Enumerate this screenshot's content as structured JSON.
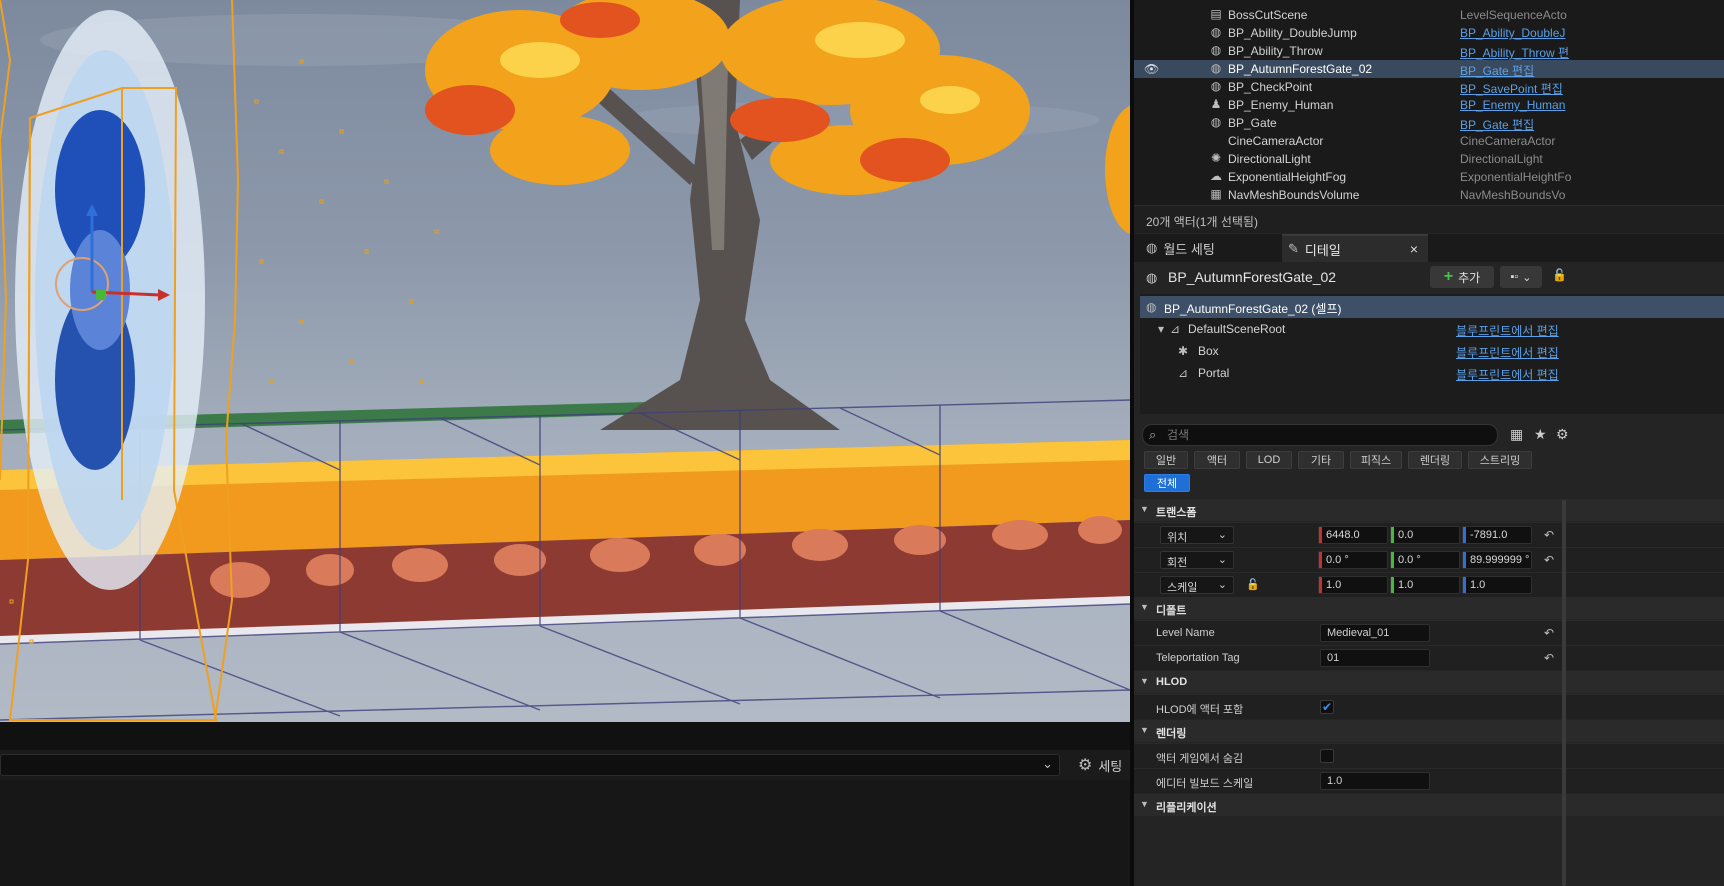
{
  "outliner": {
    "rows": [
      {
        "name": "BossCutScene",
        "type": "LevelSequenceActo",
        "link": false,
        "selected": false,
        "icon": "sequence-icon",
        "glyph": "▤"
      },
      {
        "name": "BP_Ability_DoubleJump",
        "type": "BP_Ability_DoubleJ",
        "link": true,
        "selected": false,
        "icon": "blueprint-actor-icon",
        "glyph": "◍"
      },
      {
        "name": "BP_Ability_Throw",
        "type": "BP_Ability_Throw 편",
        "link": true,
        "selected": false,
        "icon": "blueprint-actor-icon",
        "glyph": "◍"
      },
      {
        "name": "BP_AutumnForestGate_02",
        "type": "BP_Gate 편집",
        "link": true,
        "selected": true,
        "icon": "blueprint-actor-icon",
        "glyph": "◍"
      },
      {
        "name": "BP_CheckPoint",
        "type": "BP_SavePoint 편집",
        "link": true,
        "selected": false,
        "icon": "blueprint-actor-icon",
        "glyph": "◍"
      },
      {
        "name": "BP_Enemy_Human",
        "type": "BP_Enemy_Human",
        "link": true,
        "selected": false,
        "icon": "character-icon",
        "glyph": "♟"
      },
      {
        "name": "BP_Gate",
        "type": "BP_Gate 편집",
        "link": true,
        "selected": false,
        "icon": "blueprint-actor-icon",
        "glyph": "◍"
      },
      {
        "name": "CineCameraActor",
        "type": "CineCameraActor",
        "link": false,
        "selected": false,
        "icon": "camera-icon",
        "glyph": ""
      },
      {
        "name": "DirectionalLight",
        "type": "DirectionalLight",
        "link": false,
        "selected": false,
        "icon": "sun-icon",
        "glyph": "✺"
      },
      {
        "name": "ExponentialHeightFog",
        "type": "ExponentialHeightFo",
        "link": false,
        "selected": false,
        "icon": "fog-icon",
        "glyph": "☁"
      },
      {
        "name": "NavMeshBoundsVolume",
        "type": "NavMeshBoundsVo",
        "link": false,
        "selected": false,
        "icon": "volume-icon",
        "glyph": "▦"
      }
    ],
    "status": "20개 액터(1개 선택됨)"
  },
  "tabs": {
    "world_settings": "월드 세팅",
    "details": "디테일",
    "close": "×"
  },
  "details": {
    "title": "BP_AutumnForestGate_02",
    "add_label": "추가",
    "components": [
      {
        "name": "BP_AutumnForestGate_02 (셀프)",
        "link": "",
        "selected": true,
        "icon": "blueprint-actor-icon"
      },
      {
        "name": "DefaultSceneRoot",
        "link": "블루프린트에서 편집",
        "selected": false,
        "icon": "scene-root-icon"
      },
      {
        "name": "Box",
        "link": "블루프린트에서 편집",
        "selected": false,
        "icon": "box-collision-icon"
      },
      {
        "name": "Portal",
        "link": "블루프린트에서 편집",
        "selected": false,
        "icon": "particle-system-icon"
      }
    ],
    "search_placeholder": "검색",
    "filters": [
      "일반",
      "액터",
      "LOD",
      "기타",
      "피직스",
      "렌더링",
      "스트리밍"
    ],
    "filter_all": "전체",
    "sections": {
      "transform": "트랜스폼",
      "default": "디폴트",
      "hlod": "HLOD",
      "rendering": "렌더링",
      "replication": "리플리케이션"
    },
    "transform": {
      "location": {
        "label": "위치",
        "x": "6448.0",
        "y": "0.0",
        "z": "-7891.0"
      },
      "rotation": {
        "label": "회전",
        "x": "0.0 °",
        "y": "0.0 °",
        "z": "89.999999 °"
      },
      "scale": {
        "label": "스케일",
        "x": "1.0",
        "y": "1.0",
        "z": "1.0"
      }
    },
    "default": {
      "level_name_label": "Level Name",
      "level_name_value": "Medieval_01",
      "tag_label": "Teleportation Tag",
      "tag_value": "01"
    },
    "hlod": {
      "include_label": "HLOD에 액터 포함",
      "include_checked": true
    },
    "rendering": {
      "hide_label": "액터 게임에서 숨김",
      "hide_checked": false,
      "billboard_label": "에디터 빌보드 스케일",
      "billboard_value": "1.0"
    }
  },
  "viewport_bar": {
    "settings_label": "세팅"
  },
  "colors": {
    "accent": "#1f6fd6",
    "selection": "#3a4a5e",
    "link": "#5aa0e8",
    "x_axis": "#c8312b",
    "y_axis": "#46b83a",
    "z_axis": "#2f6fd8"
  }
}
